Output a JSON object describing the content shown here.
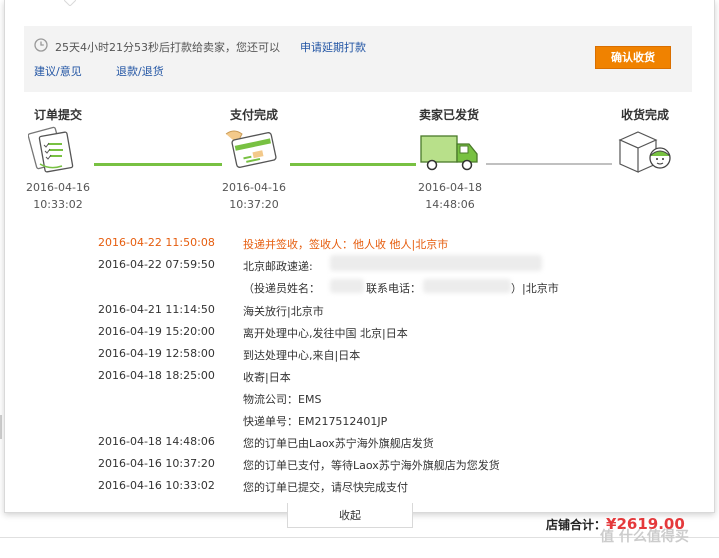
{
  "banner": {
    "countdown_text": "25天4小时21分53秒后打款给卖家，您还可以",
    "extend_link": "申请延期打款",
    "suggestion_link": "建议/意见",
    "refund_link": "退款/退货",
    "confirm_button": "确认收货"
  },
  "steps": [
    {
      "title": "订单提交",
      "date": "2016-04-16",
      "time": "10:33:02",
      "icon": "order-document-icon"
    },
    {
      "title": "支付完成",
      "date": "2016-04-16",
      "time": "10:37:20",
      "icon": "payment-card-icon"
    },
    {
      "title": "卖家已发货",
      "date": "2016-04-18",
      "time": "14:48:06",
      "icon": "delivery-truck-icon"
    },
    {
      "title": "收货完成",
      "date": "",
      "time": "",
      "icon": "package-received-icon"
    }
  ],
  "colors": {
    "accent": "#f08200",
    "progress_done": "#78c142",
    "highlight": "#e65d0e",
    "link": "#2255a4",
    "price": "#e4393c"
  },
  "logs": [
    {
      "time": "2016-04-22 11:50:08",
      "text": "投递并签收，签收人：他人收 他人|北京市",
      "highlight": true
    },
    {
      "time": "2016-04-22 07:59:50",
      "text": "北京邮政速递:"
    },
    {
      "time": "",
      "text": "（投递员姓名：",
      "text2": "联系电话：",
      "text3": "）|北京市"
    },
    {
      "time": "2016-04-21 11:14:50",
      "text": "海关放行|北京市"
    },
    {
      "time": "2016-04-19 15:20:00",
      "text": "离开处理中心,发往中国 北京|日本"
    },
    {
      "time": "2016-04-19 12:58:00",
      "text": "到达处理中心,来自|日本"
    },
    {
      "time": "2016-04-18 18:25:00",
      "text": "收寄|日本"
    },
    {
      "time": "",
      "text": "物流公司：EMS"
    },
    {
      "time": "",
      "text": "快递单号：EM217512401JP"
    },
    {
      "time": "2016-04-18 14:48:06",
      "text": "您的订单已由Laox苏宁海外旗舰店发货"
    },
    {
      "time": "2016-04-16 10:37:20",
      "text": "您的订单已支付，等待Laox苏宁海外旗舰店为您发货"
    },
    {
      "time": "2016-04-16 10:33:02",
      "text": "您的订单已提交，请尽快完成支付"
    }
  ],
  "collapse_label": "收起",
  "total": {
    "label": "店铺合计：",
    "amount": "¥2619.00"
  },
  "watermark": "值 什么值得买"
}
